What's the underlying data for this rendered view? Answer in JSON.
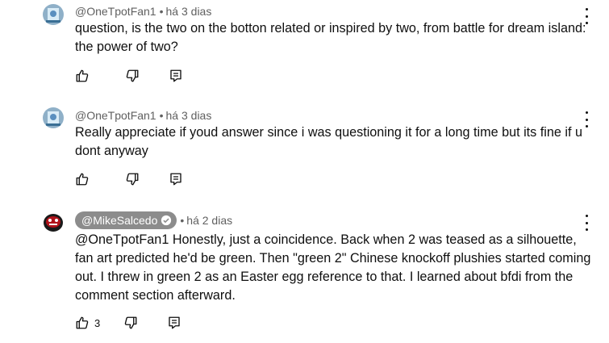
{
  "comments": [
    {
      "author": "@OneTpotFan1",
      "separator": "•",
      "time": "há 3 dias",
      "text": "question, is the two on the botton related or inspired by two, from battle for dream island: the power of two?",
      "is_owner": false,
      "likes": ""
    },
    {
      "author": "@OneTpotFan1",
      "separator": "•",
      "time": "há 3 dias",
      "text": "Really appreciate if youd answer since i was questioning it for a long time but its fine if u dont anyway",
      "is_owner": false,
      "likes": ""
    },
    {
      "author": "@MikeSalcedo",
      "separator": "•",
      "time": "há 2 dias",
      "text": "@OneTpotFan1  Honestly, just a coincidence. Back when 2 was teased as a silhouette, fan art predicted he'd be green. Then \"green 2\" Chinese knockoff plushies started coming out. I threw in green 2 as an Easter egg reference to that.  I learned about bfdi from the comment section afterward.",
      "is_owner": true,
      "verified": true,
      "likes": "3"
    }
  ],
  "icons": {
    "like": "thumb-up-icon",
    "dislike": "thumb-down-icon",
    "reply": "reply-comment-icon",
    "menu": "more-vertical-icon",
    "verified": "checkmark-verified-icon"
  },
  "colors": {
    "text": "#0f0f0f",
    "meta": "#606060",
    "owner_badge": "#8c8c8c"
  }
}
